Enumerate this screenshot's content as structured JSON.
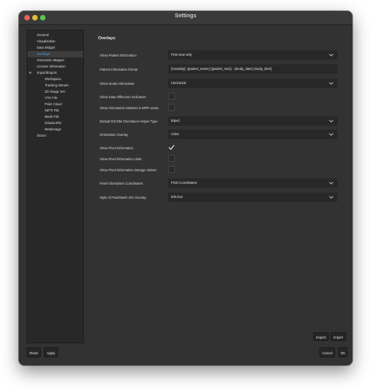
{
  "window": {
    "title": "Settings"
  },
  "sidebar": {
    "items": [
      {
        "label": "General"
      },
      {
        "label": "Visualization"
      },
      {
        "label": "Data Widget"
      },
      {
        "label": "Overlays",
        "selected": true
      },
      {
        "label": "Interaction Mapper"
      },
      {
        "label": "License Information"
      },
      {
        "label": "Import/Export",
        "expanded": true
      },
      {
        "label": "Workspace"
      },
      {
        "label": "Tracking Stream"
      },
      {
        "label": "2D Image Set"
      },
      {
        "label": "VTK File"
      },
      {
        "label": "Point Cloud"
      },
      {
        "label": "NIFTI File"
      },
      {
        "label": "Mesh File"
      },
      {
        "label": "InfusionFile"
      },
      {
        "label": "MetaImage"
      },
      {
        "label": "Dicom"
      }
    ]
  },
  "overlays": {
    "section_title": "Overlays",
    "show_patient_information": {
      "label": "Show Patient Information",
      "value": "First view only"
    },
    "patient_information_format": {
      "label": "Patient Information format",
      "value": "{modality}: {patient_name} ({patient_sex}) - {study_date} {study_time}"
    },
    "show_scale_information": {
      "label": "Show Scale Information",
      "value": "Horizontal"
    },
    "show_data_offscreen_indicators": {
      "label": "Show Data Offscreen Indicators",
      "checked": false
    },
    "show_orientation_markers_mpr": {
      "label": "Show Orientation Markers in MPR views",
      "checked": false
    },
    "default_dicom_orientation_helper_type": {
      "label": "Default DICOM Orientation Helper Type",
      "value": "Biped"
    },
    "orientation_overlay": {
      "label": "Orientation Overlay",
      "value": "Cube"
    },
    "show_pixel_information": {
      "label": "Show Pixel Information",
      "checked": true
    },
    "show_pixel_information_units": {
      "label": "Show Pixel Information Units",
      "checked": false
    },
    "show_pixel_information_storage_values": {
      "label": "Show Pixel Information Storage Values",
      "checked": false
    },
    "pixel_information_coordinates": {
      "label": "Pixel Information Coordinates",
      "value": "Pixel Coordinates"
    },
    "style_pixel_mesh_info_overlay": {
      "label": "Style of Pixel/Mesh Info Overlay",
      "value": "Info box"
    }
  },
  "buttons": {
    "export": "Export",
    "import": "Import",
    "reset": "Reset",
    "apply": "Apply",
    "cancel": "Cancel",
    "ok": "OK"
  },
  "colors": {
    "window_bg": "#323232",
    "sidebar_bg": "#282828",
    "selected_text": "#4ba3e8",
    "control_bg": "#282828"
  }
}
